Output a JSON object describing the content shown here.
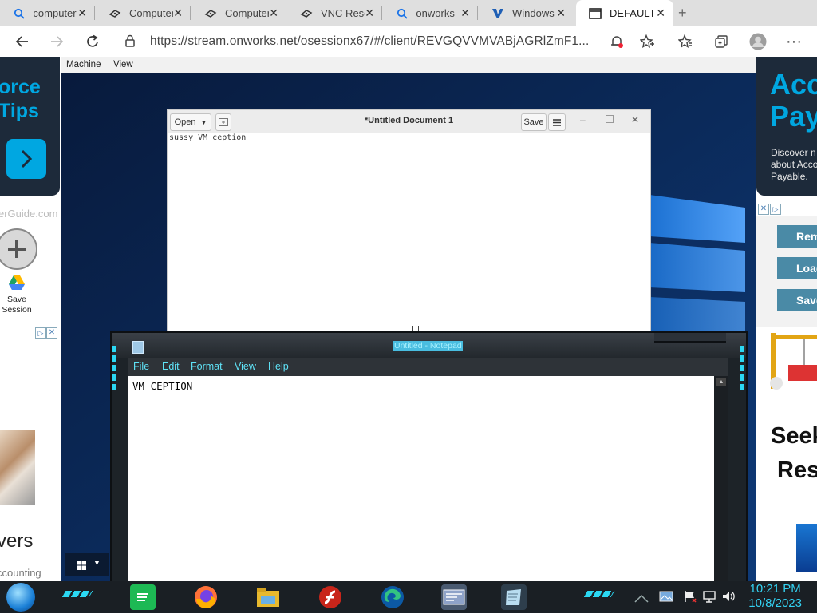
{
  "tabs": [
    {
      "title": "computer",
      "icon": "search-icon"
    },
    {
      "title": "Computer",
      "icon": "gitbook-icon"
    },
    {
      "title": "Computer",
      "icon": "gitbook-icon"
    },
    {
      "title": "VNC Reso",
      "icon": "gitbook-icon"
    },
    {
      "title": "onworks",
      "icon": "search-icon"
    },
    {
      "title": "Windows",
      "icon": "v-logo-icon"
    },
    {
      "title": "DEFAULT",
      "icon": "window-icon",
      "active": true
    }
  ],
  "address": {
    "url": "https://stream.onworks.net/osessionx67/#/client/REVGQVVMVABjAGRlZmF1..."
  },
  "vnc_menu": [
    "Machine",
    "View"
  ],
  "gedit": {
    "open_label": "Open",
    "title": "*Untitled Document 1",
    "save_label": "Save",
    "content": "sussy VM ception"
  },
  "notepad": {
    "title": "Untitled - Notepad",
    "menu": [
      "File",
      "Edit",
      "Format",
      "View",
      "Help"
    ],
    "content": "VM CEPTION"
  },
  "left_ad": {
    "line1": "orce",
    "line2": "Tips",
    "domain": "erGuide.com",
    "save_session": "Save Session",
    "big": "vers",
    "small": "ccounting"
  },
  "right_ad": {
    "line1": "Acc",
    "line2": "Pay",
    "desc": "Discover n about Acco Payable.",
    "btn1": "Rem",
    "btn2": "Load",
    "btn3": "Save",
    "seek1": "Seek",
    "seek2": "Res"
  },
  "clock": {
    "time": "10:21 PM",
    "date": "10/8/2023"
  },
  "colors": {
    "accent_cyan": "#34d2f2",
    "ad_dark": "#1d2a3a",
    "ad_blue": "#00a7e1"
  }
}
